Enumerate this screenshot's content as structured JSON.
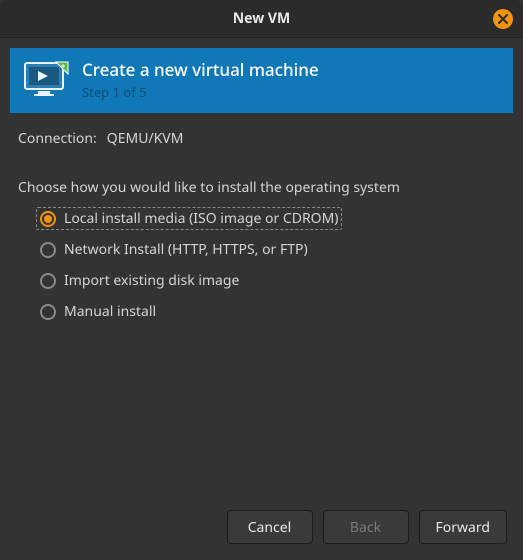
{
  "window": {
    "title": "New VM"
  },
  "banner": {
    "title": "Create a new virtual machine",
    "step": "Step 1 of 5"
  },
  "connection": {
    "label": "Connection:",
    "value": "QEMU/KVM"
  },
  "prompt": "Choose how you would like to install the operating system",
  "options": [
    {
      "label": "Local install media (ISO image or CDROM)",
      "selected": true
    },
    {
      "label": "Network Install (HTTP, HTTPS, or FTP)",
      "selected": false
    },
    {
      "label": "Import existing disk image",
      "selected": false
    },
    {
      "label": "Manual install",
      "selected": false
    }
  ],
  "buttons": {
    "cancel": "Cancel",
    "back": "Back",
    "forward": "Forward"
  }
}
